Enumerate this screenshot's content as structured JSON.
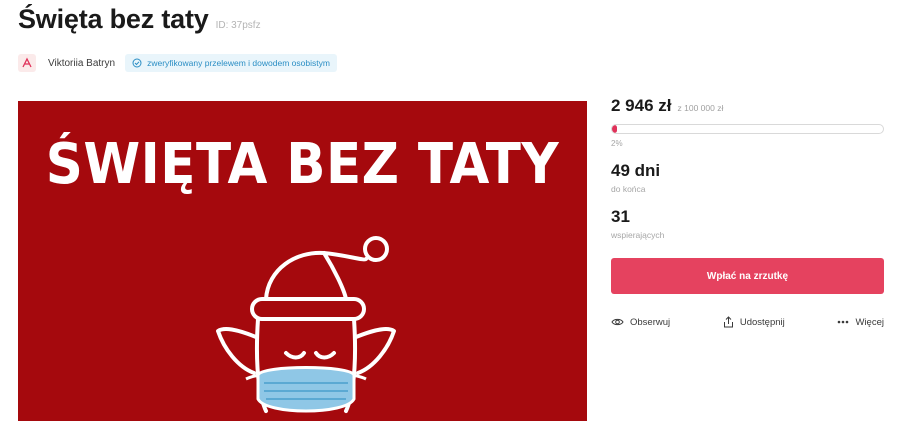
{
  "header": {
    "title": "Święta bez taty",
    "id": "ID: 37psfz"
  },
  "author": {
    "name": "Viktoriia Batryn",
    "verified": "zweryfikowany przelewem i dowodem osobistym"
  },
  "banner": {
    "text": "ŚWIĘTA BEZ TATY",
    "background": "#a5090d"
  },
  "funding": {
    "amount": "2 946 zł",
    "goal": "z 100 000 zł",
    "percent_label": "2%",
    "progress": 0.02,
    "days": "49 dni",
    "days_label": "do końca",
    "supporters": "31",
    "supporters_label": "wspierających"
  },
  "donate_label": "Wpłać na zrzutkę",
  "actions": {
    "observe": "Obserwuj",
    "share": "Udostępnij",
    "more": "Więcej"
  },
  "colors": {
    "accent": "#e5425f",
    "verified_text": "#2b8ec4"
  },
  "icons": [
    "logo-icon",
    "check-circle-icon",
    "eye-icon",
    "share-icon",
    "dots-icon",
    "elf-mask-illustration"
  ]
}
